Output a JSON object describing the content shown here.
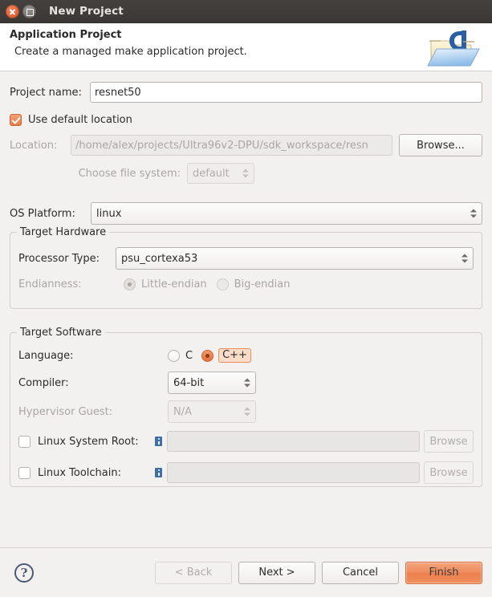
{
  "window": {
    "title": "New Project",
    "close_icon": "close-icon",
    "maximize_icon": "maximize-icon"
  },
  "header": {
    "title": "Application Project",
    "subtitle": "Create a managed make application project.",
    "icon": "c-project-folder-icon"
  },
  "form": {
    "project_name_label": "Project name:",
    "project_name_value": "resnet50",
    "use_default_location_label": "Use default location",
    "use_default_location_checked": true,
    "location_label": "Location:",
    "location_value": "/home/alex/projects/Ultra96v2-DPU/sdk_workspace/resn",
    "browse_label": "Browse...",
    "file_system_label": "Choose file system:",
    "file_system_value": "default",
    "os_platform_label": "OS Platform:",
    "os_platform_value": "linux"
  },
  "target_hardware": {
    "group_title": "Target Hardware",
    "processor_type_label": "Processor Type:",
    "processor_type_value": "psu_cortexa53",
    "endianness_label": "Endianness:",
    "endian_little_label": "Little-endian",
    "endian_big_label": "Big-endian",
    "endian_selected": "Little-endian"
  },
  "target_software": {
    "group_title": "Target Software",
    "language_label": "Language:",
    "language_c_label": "C",
    "language_cpp_label": "C++",
    "language_selected": "C++",
    "compiler_label": "Compiler:",
    "compiler_value": "64-bit",
    "hypervisor_label": "Hypervisor Guest:",
    "hypervisor_value": "N/A",
    "sysroot_label": "Linux System Root:",
    "sysroot_value": "",
    "sysroot_checked": false,
    "sysroot_browse_label": "Browse",
    "toolchain_label": "Linux Toolchain:",
    "toolchain_value": "",
    "toolchain_checked": false,
    "toolchain_browse_label": "Browse",
    "info_icon": "info-icon"
  },
  "footer": {
    "help_icon": "help-icon",
    "help_glyph": "?",
    "back_label": "< Back",
    "next_label": "Next >",
    "cancel_label": "Cancel",
    "finish_label": "Finish"
  },
  "colors": {
    "accent": "#e97a46",
    "titlebar": "#3b3735",
    "body": "#f2f1f0",
    "info_blue": "#3f6fa8"
  }
}
